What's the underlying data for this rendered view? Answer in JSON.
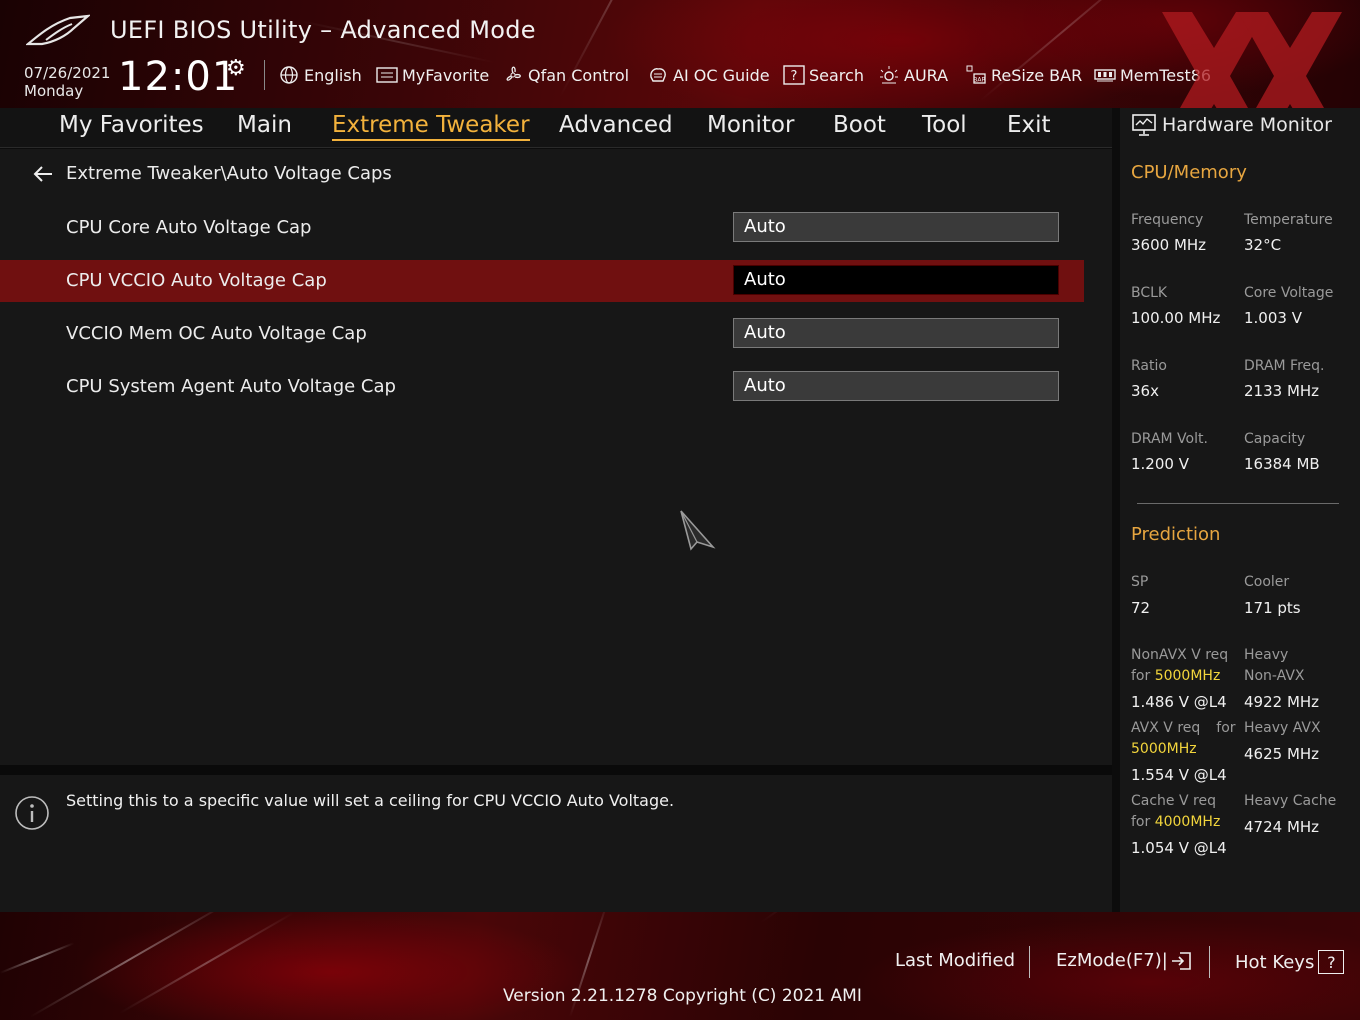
{
  "header": {
    "app_title": "UEFI BIOS Utility – Advanced Mode",
    "date": "07/26/2021",
    "weekday": "Monday",
    "time": "12:01"
  },
  "toolbar": {
    "language": "English",
    "my_favorite": "MyFavorite",
    "qfan": "Qfan Control",
    "ai_oc": "AI OC Guide",
    "search": "Search",
    "aura": "AURA",
    "resize_bar": "ReSize BAR",
    "memtest": "MemTest86"
  },
  "nav": {
    "tabs": [
      {
        "label": "My Favorites"
      },
      {
        "label": "Main"
      },
      {
        "label": "Extreme Tweaker"
      },
      {
        "label": "Advanced"
      },
      {
        "label": "Monitor"
      },
      {
        "label": "Boot"
      },
      {
        "label": "Tool"
      },
      {
        "label": "Exit"
      }
    ],
    "active": "Extreme Tweaker"
  },
  "main": {
    "breadcrumb": "Extreme Tweaker\\Auto Voltage Caps",
    "settings": [
      {
        "label": "CPU Core Auto Voltage Cap",
        "value": "Auto"
      },
      {
        "label": "CPU VCCIO Auto Voltage Cap",
        "value": "Auto"
      },
      {
        "label": "VCCIO Mem OC Auto Voltage Cap",
        "value": "Auto"
      },
      {
        "label": "CPU System Agent Auto Voltage Cap",
        "value": "Auto"
      }
    ],
    "selected_index": 1
  },
  "help": {
    "text": "Setting this to a specific value will set a ceiling for CPU VCCIO Auto Voltage."
  },
  "hw_monitor": {
    "title": "Hardware Monitor",
    "cpu_memory": {
      "title": "CPU/Memory",
      "frequency_label": "Frequency",
      "frequency": "3600 MHz",
      "temperature_label": "Temperature",
      "temperature": "32°C",
      "bclk_label": "BCLK",
      "bclk": "100.00 MHz",
      "core_voltage_label": "Core Voltage",
      "core_voltage": "1.003 V",
      "ratio_label": "Ratio",
      "ratio": "36x",
      "dram_freq_label": "DRAM Freq.",
      "dram_freq": "2133 MHz",
      "dram_volt_label": "DRAM Volt.",
      "dram_volt": "1.200 V",
      "capacity_label": "Capacity",
      "capacity": "16384 MB"
    },
    "prediction": {
      "title": "Prediction",
      "sp_label": "SP",
      "sp": "72",
      "cooler_label": "Cooler",
      "cooler": "171 pts",
      "nonavx_label_1": "NonAVX V req",
      "nonavx_label_for": "for",
      "nonavx_freq": "5000MHz",
      "nonavx_value": "1.486 V @L4",
      "heavy_nonavx_label_1": "Heavy",
      "heavy_nonavx_label_2": "Non-AVX",
      "heavy_nonavx_value": "4922 MHz",
      "avx_label_1": "AVX V req",
      "avx_label_for": "for",
      "avx_freq": "5000MHz",
      "avx_value": "1.554 V @L4",
      "heavy_avx_label": "Heavy AVX",
      "heavy_avx_value": "4625 MHz",
      "cache_label_1": "Cache V req",
      "cache_label_for": "for",
      "cache_freq": "4000MHz",
      "cache_value": "1.054 V @L4",
      "heavy_cache_label": "Heavy Cache",
      "heavy_cache_value": "4724 MHz"
    }
  },
  "footer": {
    "last_modified": "Last Modified",
    "ezmode": "EzMode(F7)|",
    "hot_keys": "Hot Keys",
    "hot_keys_glyph": "?",
    "version": "Version 2.21.1278 Copyright (C) 2021 AMI"
  },
  "colors": {
    "accent": "#f3b23c",
    "section_title": "#e7a640",
    "highlight_freq": "#f2d53c",
    "selected_row": "#701010",
    "panel": "#171717"
  }
}
